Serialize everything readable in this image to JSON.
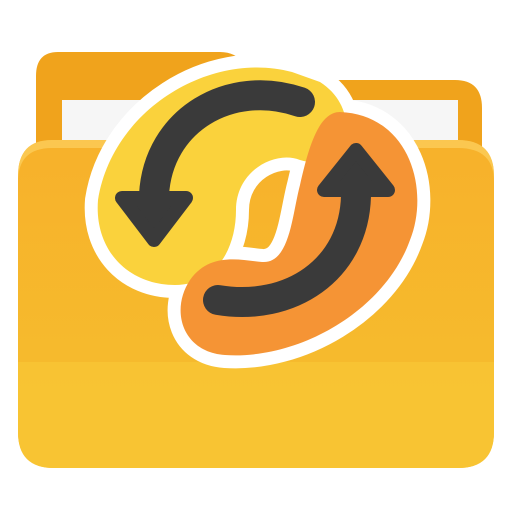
{
  "icon": {
    "name": "folder-sync-icon",
    "parts": [
      "folder-icon",
      "sync-arrows-icon"
    ],
    "colors": {
      "background": "#ffffff",
      "folder_back": "#f0a71e",
      "folder_back_shade": "#e3981a",
      "paper": "#f7f7f7",
      "folder_front_top": "#f7b530",
      "folder_front_bottom": "#f5bc2d",
      "folder_highlight": "#fbcc54",
      "sticker_outline": "#ffffff",
      "arrow_left_background": "#fad33d",
      "arrow_right_background": "#f5943a",
      "arrow": "#3a3a3a"
    }
  }
}
